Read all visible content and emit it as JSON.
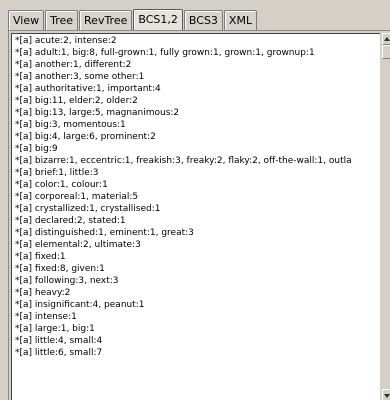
{
  "tabs": [
    {
      "label": "View",
      "active": false
    },
    {
      "label": "Tree",
      "active": false
    },
    {
      "label": "RevTree",
      "active": false
    },
    {
      "label": "BCS1,2",
      "active": true
    },
    {
      "label": "BCS3",
      "active": false
    },
    {
      "label": "XML",
      "active": false
    }
  ],
  "content": {
    "lines": [
      "*[a] acute:2, intense:2",
      "*[a] adult:1, big:8, full-grown:1, fully grown:1, grown:1, grownup:1",
      "*[a] another:1, different:2",
      "*[a] another:3, some other:1",
      "*[a] authoritative:1, important:4",
      "*[a] big:11, elder:2, older:2",
      "*[a] big:13, large:5, magnanimous:2",
      "*[a] big:3, momentous:1",
      "*[a] big:4, large:6, prominent:2",
      "*[a] big:9",
      "*[a] bizarre:1, eccentric:1, freakish:3, freaky:2, flaky:2, off-the-wall:1, outla",
      "*[a] brief:1, little:3",
      "*[a] color:1, colour:1",
      "*[a] corporeal:1, material:5",
      "*[a] crystallized:1, crystallised:1",
      "*[a] declared:2, stated:1",
      "*[a] distinguished:1, eminent:1, great:3",
      "*[a] elemental:2, ultimate:3",
      "*[a] fixed:1",
      "*[a] fixed:8, given:1",
      "*[a] following:3, next:3",
      "*[a] heavy:2",
      "*[a] insignificant:4, peanut:1",
      "*[a] intense:1",
      "*[a] large:1, big:1",
      "*[a] little:4, small:4",
      "*[a] little:6, small:7"
    ]
  }
}
